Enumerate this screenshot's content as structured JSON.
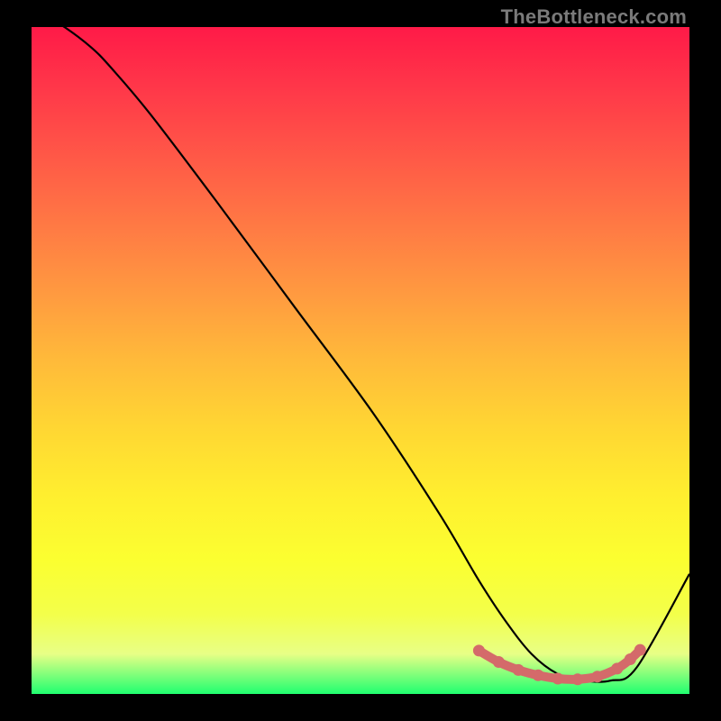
{
  "watermark": "TheBottleneck.com",
  "chart_data": {
    "type": "line",
    "title": "",
    "xlabel": "",
    "ylabel": "",
    "xlim": [
      0,
      100
    ],
    "ylim": [
      0,
      100
    ],
    "series": [
      {
        "name": "bottleneck-curve",
        "x": [
          0,
          5,
          9,
          12,
          18,
          28,
          40,
          52,
          62,
          68,
          72,
          76,
          80,
          84,
          88,
          92,
          100
        ],
        "y": [
          103,
          100,
          97,
          94,
          87,
          74,
          58,
          42,
          27,
          17,
          11,
          6,
          3,
          2,
          2,
          4,
          18
        ]
      }
    ],
    "highlight": {
      "name": "optimal-range",
      "color": "#d46a6a",
      "points": [
        {
          "x": 68,
          "y": 6.5
        },
        {
          "x": 71,
          "y": 4.8
        },
        {
          "x": 74,
          "y": 3.6
        },
        {
          "x": 77,
          "y": 2.8
        },
        {
          "x": 80,
          "y": 2.3
        },
        {
          "x": 83,
          "y": 2.2
        },
        {
          "x": 86,
          "y": 2.6
        },
        {
          "x": 89,
          "y": 3.8
        },
        {
          "x": 91,
          "y": 5.2
        },
        {
          "x": 92.5,
          "y": 6.6
        }
      ]
    }
  }
}
